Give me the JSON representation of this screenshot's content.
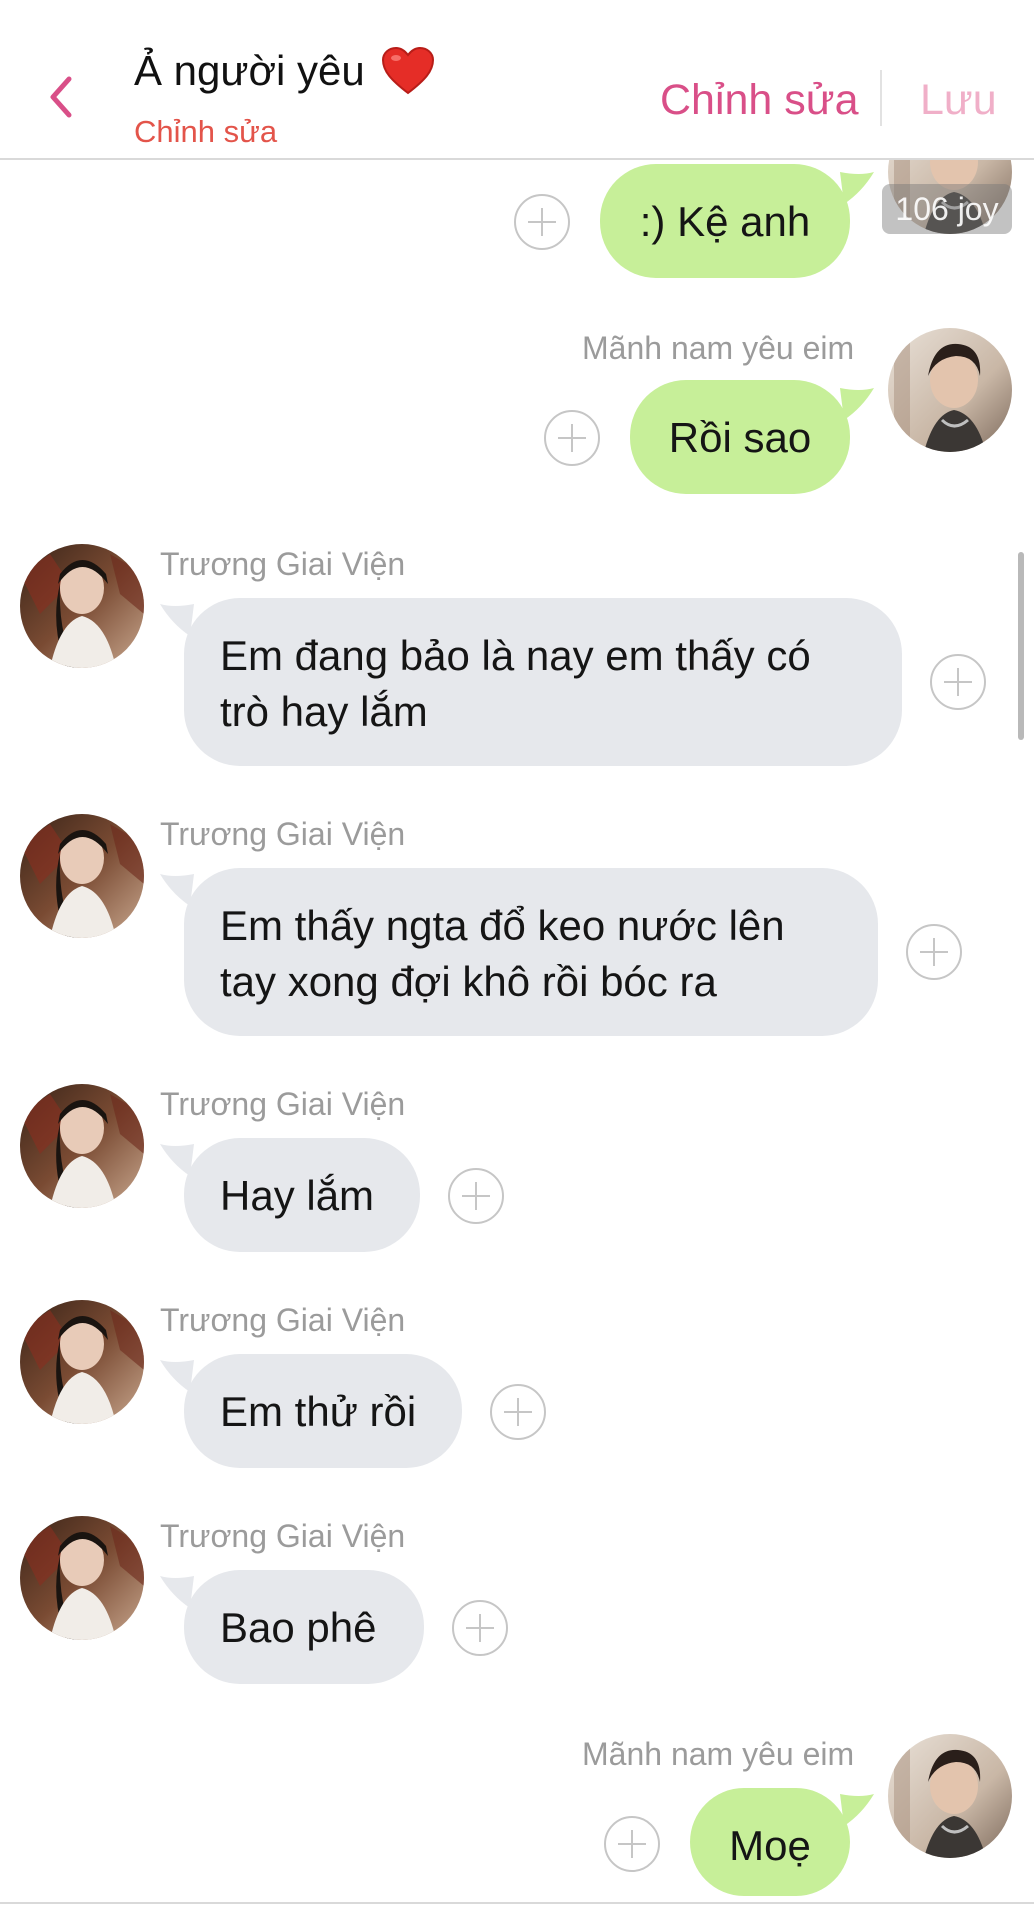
{
  "header": {
    "title": "Ả người yêu",
    "subtitle": "Chỉnh sửa",
    "edit_label": "Chỉnh sửa",
    "save_label": "Lưu"
  },
  "colors": {
    "accent": "#d94f88",
    "subtitle": "#e3544a",
    "outgoing_bubble": "#c7ef99",
    "incoming_bubble": "#e6e8ec"
  },
  "watermark": "106 joy",
  "messages": [
    {
      "direction": "out",
      "sender": "",
      "text": ":) Kệ anh"
    },
    {
      "direction": "out",
      "sender": "Mãnh nam yêu eim",
      "text": "Rồi sao"
    },
    {
      "direction": "in",
      "sender": "Trương Giai Viện",
      "lines": [
        "Em đang bảo là nay em thấy có",
        "trò hay lắm"
      ]
    },
    {
      "direction": "in",
      "sender": "Trương Giai Viện",
      "lines": [
        "Em thấy ngta đổ keo nước lên",
        "tay xong đợi khô rồi bóc ra"
      ]
    },
    {
      "direction": "in",
      "sender": "Trương Giai Viện",
      "text": "Hay lắm"
    },
    {
      "direction": "in",
      "sender": "Trương Giai Viện",
      "text": "Em thử rồi"
    },
    {
      "direction": "in",
      "sender": "Trương Giai Viện",
      "text": "Bao phê"
    },
    {
      "direction": "out",
      "sender": "Mãnh nam yêu eim",
      "text": "Moẹ"
    }
  ]
}
